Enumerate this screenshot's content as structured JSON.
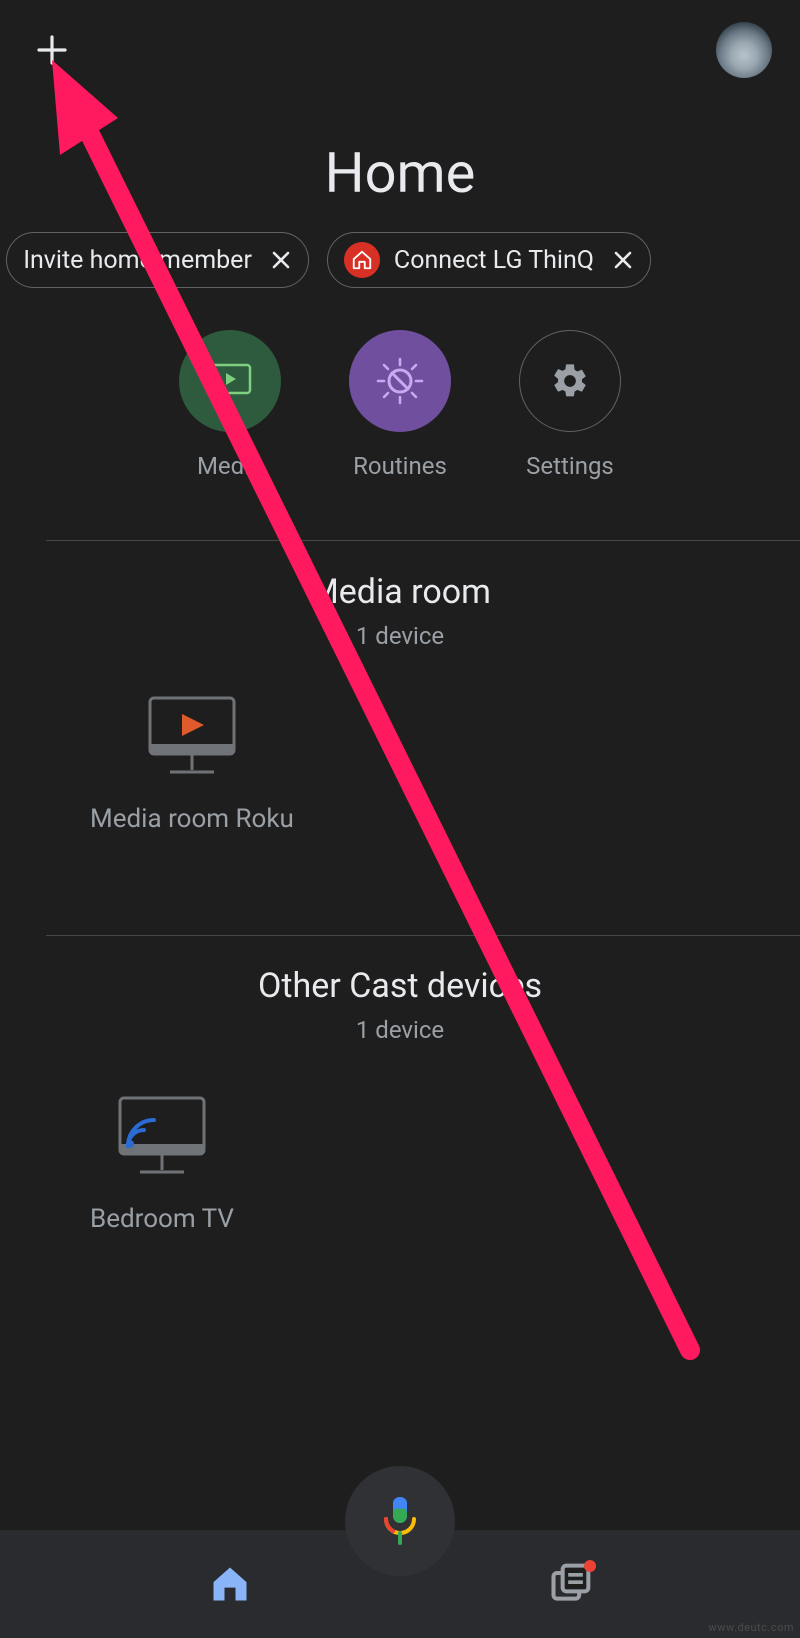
{
  "header": {
    "title": "Home"
  },
  "chips": [
    {
      "label": "Invite home member"
    },
    {
      "label": "Connect LG ThinQ",
      "icon": "home-badge"
    }
  ],
  "quick_actions": {
    "media": "Media",
    "routines": "Routines",
    "settings": "Settings"
  },
  "rooms": [
    {
      "title": "Media room",
      "subtitle": "1 device",
      "devices": [
        {
          "label": "Media room Roku",
          "type": "roku-tv"
        }
      ]
    },
    {
      "title": "Other Cast devices",
      "subtitle": "1 device",
      "devices": [
        {
          "label": "Bedroom TV",
          "type": "cast-tv"
        }
      ]
    }
  ],
  "annotation": {
    "arrow_color": "#ff1a60"
  },
  "watermark": "www.deutc.com"
}
